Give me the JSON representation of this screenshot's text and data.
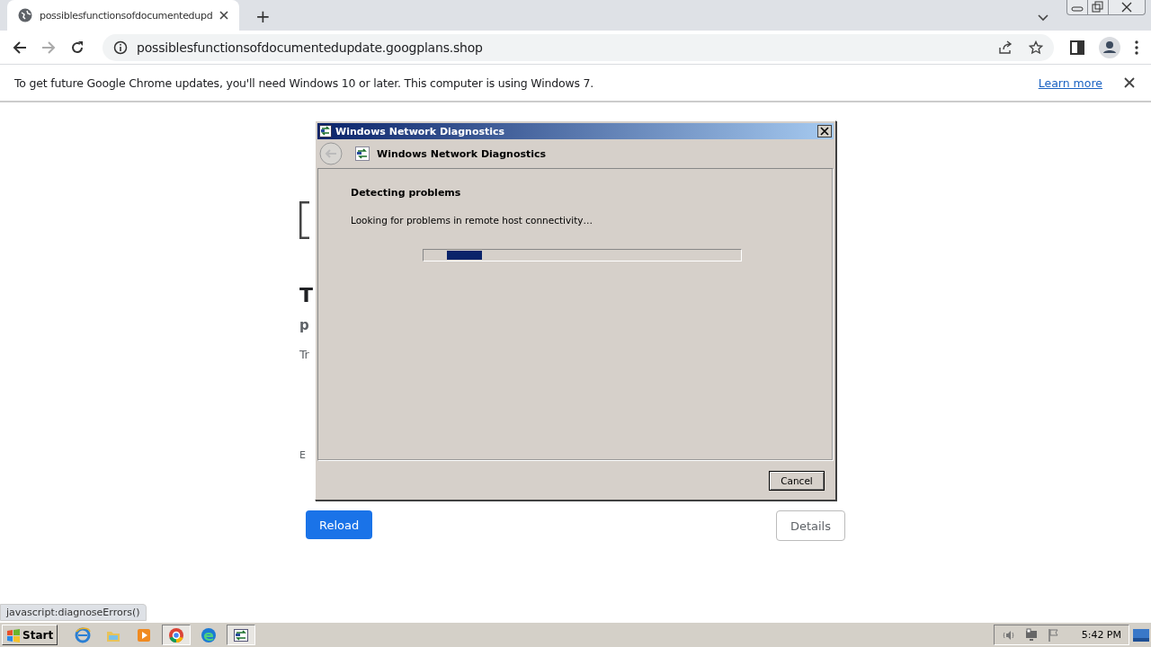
{
  "browser": {
    "tab": {
      "title": "possiblesfunctionsofdocumentedupd",
      "selected": true
    },
    "new_tab": "+",
    "address": "possiblesfunctionsofdocumentedupdate.googplans.shop"
  },
  "infobar": {
    "message": "To get future Google Chrome updates, you'll need Windows 10 or later. This computer is using Windows 7.",
    "link": "Learn more"
  },
  "page": {
    "heading": "T",
    "subheading": "p",
    "body": "Tr",
    "error_code": "E",
    "buttons": [
      {
        "label": "Reload",
        "kind": "primary"
      },
      {
        "label": "Details",
        "kind": "secondary"
      }
    ]
  },
  "dialog": {
    "title": "Windows Network Diagnostics",
    "header": "Windows Network Diagnostics",
    "section": "Detecting problems",
    "status": "Looking for problems in remote host connectivity…",
    "progress": {
      "indeterminate": true
    },
    "buttons": [
      "Cancel"
    ]
  },
  "status_tooltip": "javascript:diagnoseErrors()",
  "taskbar": {
    "start": "Start",
    "apps": [
      {
        "kind": "ie",
        "selected": false
      },
      {
        "kind": "explorer",
        "selected": false
      },
      {
        "kind": "media",
        "selected": false
      },
      {
        "kind": "chrome",
        "selected": true
      },
      {
        "kind": "edge",
        "selected": false
      },
      {
        "kind": "diag",
        "selected": true
      }
    ],
    "clock": "5:42 PM"
  }
}
